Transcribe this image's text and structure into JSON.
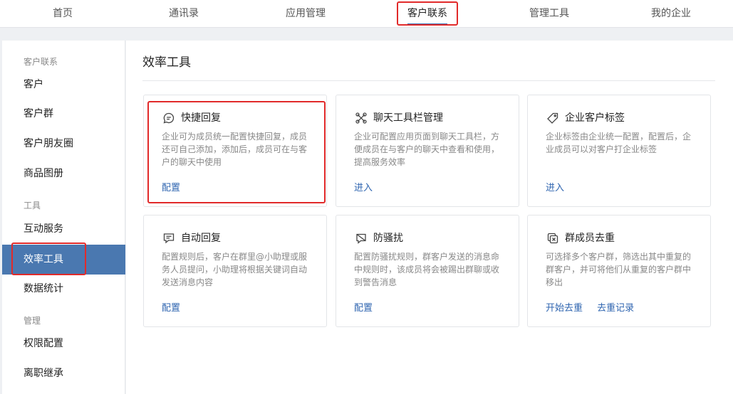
{
  "topnav": {
    "items": [
      {
        "label": "首页"
      },
      {
        "label": "通讯录"
      },
      {
        "label": "应用管理"
      },
      {
        "label": "客户联系"
      },
      {
        "label": "管理工具"
      },
      {
        "label": "我的企业"
      }
    ],
    "active": "客户联系"
  },
  "sidebar": {
    "groups": [
      {
        "title": "客户联系",
        "items": [
          "客户",
          "客户群",
          "客户朋友圈",
          "商品图册"
        ]
      },
      {
        "title": "工具",
        "items": [
          "互动服务",
          "效率工具",
          "数据统计"
        ]
      },
      {
        "title": "管理",
        "items": [
          "权限配置",
          "离职继承"
        ]
      }
    ],
    "active": "效率工具"
  },
  "main": {
    "title": "效率工具",
    "cards": [
      {
        "icon": "chat-bubble-icon",
        "title": "快捷回复",
        "desc": "企业可为成员统一配置快捷回复，成员还可自己添加，添加后，成员可在与客户的聊天中使用",
        "links": [
          "配置"
        ]
      },
      {
        "icon": "toolbar-icon",
        "title": "聊天工具栏管理",
        "desc": "企业可配置应用页面到聊天工具栏，方便成员在与客户的聊天中查看和使用，提高服务效率",
        "links": [
          "进入"
        ]
      },
      {
        "icon": "tag-icon",
        "title": "企业客户标签",
        "desc": "企业标签由企业统一配置，配置后，企业成员可以对客户打企业标签",
        "links": [
          "进入"
        ]
      },
      {
        "icon": "auto-reply-icon",
        "title": "自动回复",
        "desc": "配置规则后，客户在群里@小助理或服务人员提问，小助理将根据关键词自动发送消息内容",
        "links": [
          "配置"
        ]
      },
      {
        "icon": "anti-harass-icon",
        "title": "防骚扰",
        "desc": "配置防骚扰规则，群客户发送的消息命中规则时，该成员将会被踢出群聊或收到警告消息",
        "links": [
          "配置"
        ]
      },
      {
        "icon": "dedupe-icon",
        "title": "群成员去重",
        "desc": "可选择多个客户群，筛选出其中重复的群客户，并可将他们从重复的客户群中移出",
        "links": [
          "开始去重",
          "去重记录"
        ]
      }
    ]
  },
  "colors": {
    "accent": "#4a78b0",
    "link": "#2f65b0",
    "highlight": "#e12a2a"
  }
}
